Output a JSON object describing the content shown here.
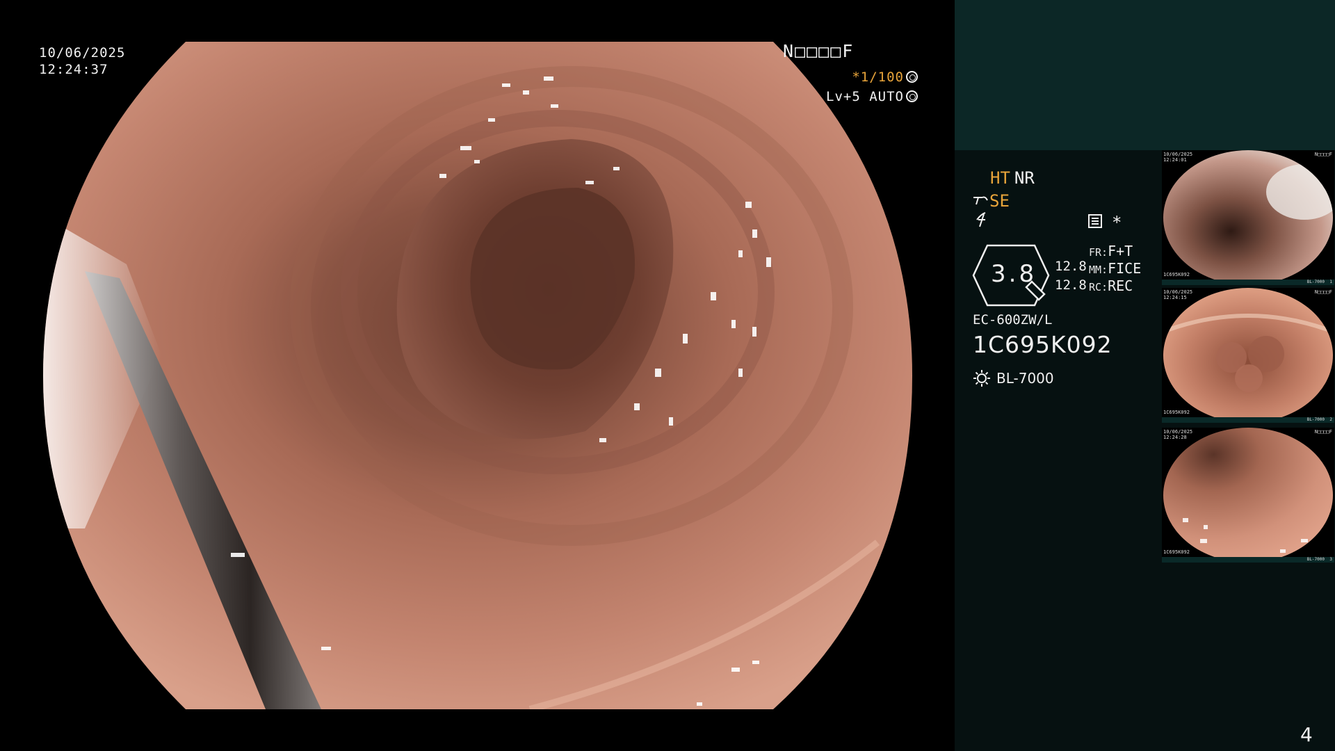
{
  "main_view": {
    "date": "10/06/2025",
    "time": "12:24:37",
    "mode_code": "N□□□□F",
    "shutter_prefix": "*",
    "shutter": "1/100",
    "level": "Lv+5 AUTO"
  },
  "panel": {
    "ht_label": "HT",
    "nr_label": "NR",
    "se_label": "SE",
    "star": "*",
    "hex_value": "3.8",
    "num_left_1": "12.8",
    "num_left_2": "12.8",
    "fr_label": "FR:",
    "fr_value": "F+T",
    "mm_label": "MM:",
    "mm_value": "FICE",
    "rc_label": "RC:",
    "rc_value": "REC",
    "scope_model": "EC-600ZW/L",
    "serial": "1C695K092",
    "light_source": "BL-7000",
    "page_number": "4"
  },
  "thumbnails": [
    {
      "date": "10/06/2025",
      "time": "12:24:01",
      "code": "N□□□□F",
      "serial": "1C695K092",
      "light": "BL-7000",
      "index": "1"
    },
    {
      "date": "10/06/2025",
      "time": "12:24:15",
      "code": "N□□□□F",
      "serial": "1C695K092",
      "light": "BL-7000",
      "index": "2"
    },
    {
      "date": "10/06/2025",
      "time": "12:24:28",
      "code": "N□□□□F",
      "serial": "1C695K092",
      "light": "BL-7000",
      "index": "3"
    }
  ],
  "colors": {
    "panel_bg": "#061111",
    "panel_top": "#0c2726",
    "accent_orange": "#e8a43a",
    "mucosa": "#b77660"
  },
  "icons": [
    "record-icon",
    "light-source-icon",
    "structure-enhancement-icon",
    "freeze-icon",
    "shutter-icon",
    "auto-iris-icon",
    "zoom-indicator-icon"
  ]
}
